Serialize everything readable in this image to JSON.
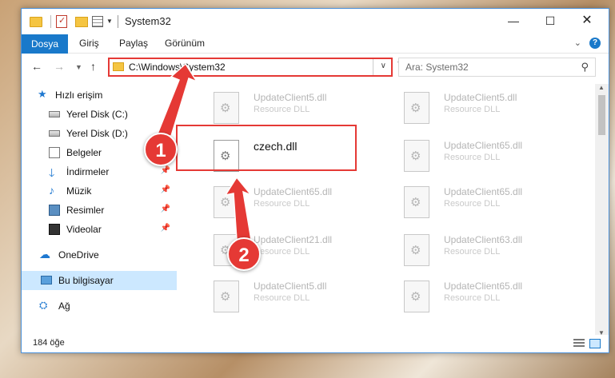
{
  "window": {
    "title": "System32",
    "controls": {
      "minimize": "—",
      "maximize": "☐",
      "close": "✕"
    }
  },
  "ribbon": {
    "tabs": [
      "Dosya",
      "Giriş",
      "Paylaş",
      "Görünüm"
    ],
    "help": "?"
  },
  "nav": {
    "address": "C:\\Windows\\System32",
    "search_placeholder": "Ara: System32"
  },
  "sidebar": {
    "items": [
      {
        "label": "Hızlı erişim",
        "icon": "star-icon"
      },
      {
        "label": "Yerel Disk (C:)",
        "icon": "drive-icon"
      },
      {
        "label": "Yerel Disk (D:)",
        "icon": "drive-icon"
      },
      {
        "label": "Belgeler",
        "icon": "document-icon"
      },
      {
        "label": "İndirmeler",
        "icon": "download-icon"
      },
      {
        "label": "Müzik",
        "icon": "music-icon"
      },
      {
        "label": "Resimler",
        "icon": "pictures-icon"
      },
      {
        "label": "Videolar",
        "icon": "video-icon"
      },
      {
        "label": "OneDrive",
        "icon": "cloud-icon"
      },
      {
        "label": "Bu bilgisayar",
        "icon": "computer-icon"
      },
      {
        "label": "Ağ",
        "icon": "network-icon"
      }
    ]
  },
  "files": [
    {
      "name": "UpdateClient5.dll",
      "type": "Resource DLL"
    },
    {
      "name": "UpdateClient5.dll",
      "type": "Resource DLL"
    },
    {
      "name": "czech.dll",
      "type": ""
    },
    {
      "name": "UpdateClient65.dll",
      "type": "Resource DLL"
    },
    {
      "name": "UpdateClient65.dll",
      "type": "Resource DLL"
    },
    {
      "name": "UpdateClient65.dll",
      "type": "Resource DLL"
    },
    {
      "name": "UpdateClient21.dll",
      "type": "Resource DLL"
    },
    {
      "name": "UpdateClient63.dll",
      "type": "Resource DLL"
    },
    {
      "name": "UpdateClient5.dll",
      "type": "Resource DLL"
    },
    {
      "name": "UpdateClient65.dll",
      "type": "Resource DLL"
    }
  ],
  "status": {
    "count": "184 öğe"
  },
  "annotations": {
    "step1": "1",
    "step2": "2"
  },
  "colors": {
    "accent": "#1979ca",
    "highlight": "#e53935",
    "selected": "#cce8ff"
  }
}
